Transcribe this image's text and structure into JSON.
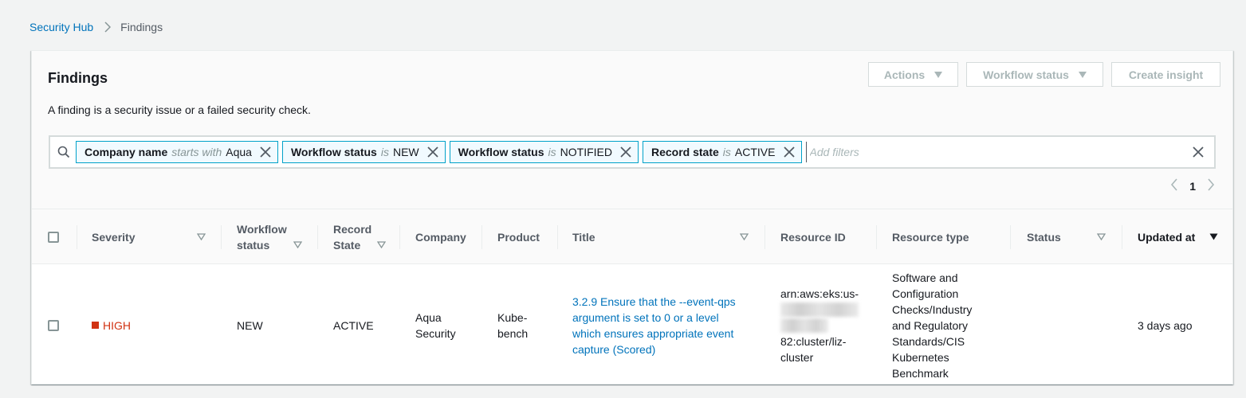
{
  "breadcrumb": {
    "parent": "Security Hub",
    "current": "Findings"
  },
  "panel": {
    "title": "Findings",
    "description": "A finding is a security issue or a failed security check."
  },
  "buttons": {
    "actions": "Actions",
    "workflow_status": "Workflow status",
    "create_insight": "Create insight"
  },
  "filters": {
    "tokens": [
      {
        "key": "Company name",
        "op": "starts with",
        "value": "Aqua"
      },
      {
        "key": "Workflow status",
        "op": "is",
        "value": "NEW"
      },
      {
        "key": "Workflow status",
        "op": "is",
        "value": "NOTIFIED"
      },
      {
        "key": "Record state",
        "op": "is",
        "value": "ACTIVE"
      }
    ],
    "placeholder": "Add filters"
  },
  "pagination": {
    "current_page": "1"
  },
  "table": {
    "headers": {
      "severity": "Severity",
      "workflow_status_1": "Workflow",
      "workflow_status_2": "status",
      "record_state_1": "Record",
      "record_state_2": "State",
      "company": "Company",
      "product": "Product",
      "title": "Title",
      "resource_id": "Resource ID",
      "resource_type": "Resource type",
      "status": "Status",
      "updated_at": "Updated at"
    },
    "rows": [
      {
        "severity": "HIGH",
        "workflow_status": "NEW",
        "record_state": "ACTIVE",
        "company_1": "Aqua",
        "company_2": "Security",
        "product_1": "Kube-",
        "product_2": "bench",
        "title_lines": [
          "3.2.9 Ensure that the --event-qps",
          "argument is set to 0 or a level",
          "which ensures appropriate event",
          "capture (Scored)"
        ],
        "resource_id_lines": [
          "arn:aws:eks:us-",
          "82:cluster/liz-",
          "cluster"
        ],
        "resource_type_lines": [
          "Software and",
          "Configuration",
          "Checks/Industry",
          "and Regulatory",
          "Standards/CIS",
          "Kubernetes",
          "Benchmark"
        ],
        "status": "",
        "updated_at": "3 days ago"
      }
    ]
  },
  "colors": {
    "link": "#0073bb",
    "severity_high": "#d13212",
    "token_border": "#00a1c9"
  }
}
